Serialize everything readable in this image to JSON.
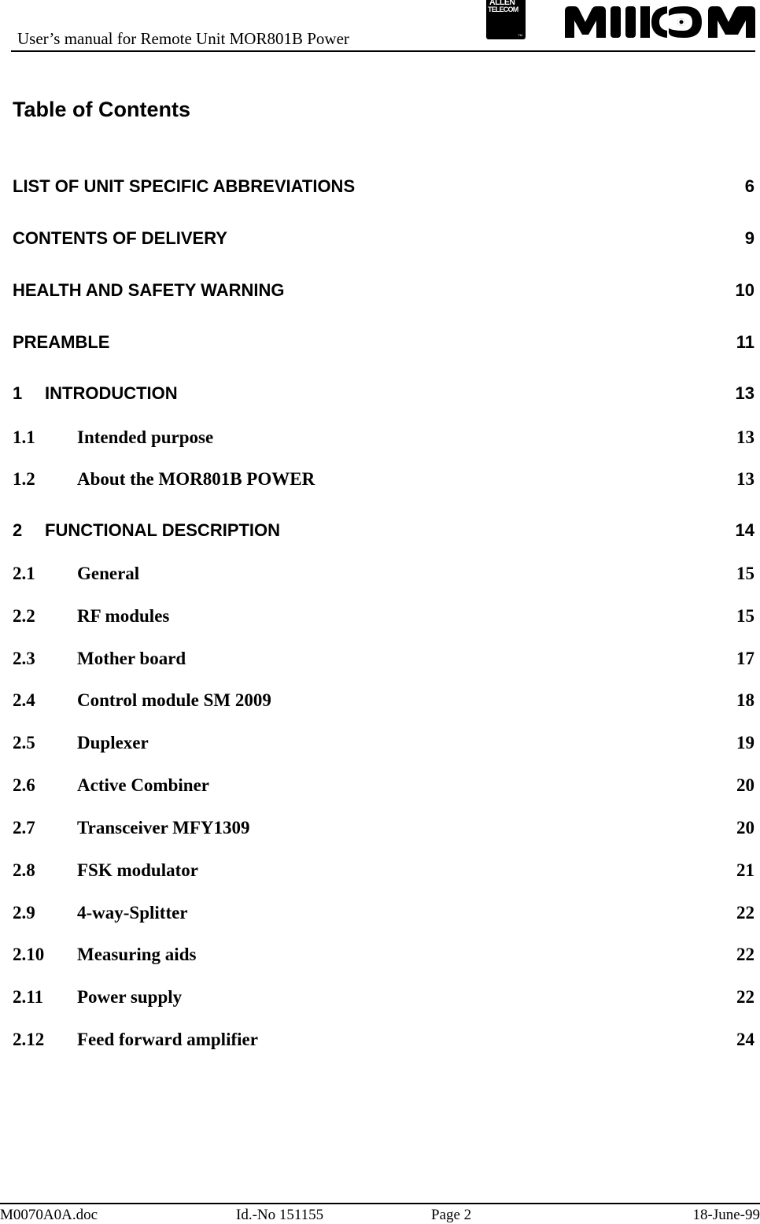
{
  "header": {
    "title": "User’s manual for Remote Unit MOR801B Power",
    "logos": {
      "allen_telecom": {
        "line1": "ALLEN",
        "line2": "TELECOM",
        "trademark": "TM"
      },
      "mikom": "MIKOM"
    }
  },
  "toc": {
    "title": "Table of Contents",
    "entries": [
      {
        "number": "",
        "label": "LIST OF UNIT SPECIFIC ABBREVIATIONS",
        "page": "6",
        "level": 0
      },
      {
        "number": "",
        "label": "CONTENTS OF DELIVERY",
        "page": "9",
        "level": 0
      },
      {
        "number": "",
        "label": "HEALTH AND SAFETY WARNING",
        "page": "10",
        "level": 0
      },
      {
        "number": "",
        "label": "PREAMBLE",
        "page": "11",
        "level": 0
      },
      {
        "number": "1",
        "label": "INTRODUCTION",
        "page": "13",
        "level": 1
      },
      {
        "number": "1.1",
        "label": "Intended purpose",
        "page": "13",
        "level": 2
      },
      {
        "number": "1.2",
        "label": "About the MOR801B POWER",
        "page": "13",
        "level": 2
      },
      {
        "number": "2",
        "label": "FUNCTIONAL DESCRIPTION",
        "page": "14",
        "level": 1
      },
      {
        "number": "2.1",
        "label": "General",
        "page": "15",
        "level": 2
      },
      {
        "number": "2.2",
        "label": "RF modules",
        "page": "15",
        "level": 2
      },
      {
        "number": "2.3",
        "label": "Mother board",
        "page": "17",
        "level": 2
      },
      {
        "number": "2.4",
        "label": "Control module SM 2009",
        "page": "18",
        "level": 2
      },
      {
        "number": "2.5",
        "label": "Duplexer",
        "page": "19",
        "level": 2
      },
      {
        "number": "2.6",
        "label": "Active Combiner",
        "page": "20",
        "level": 2
      },
      {
        "number": "2.7",
        "label": "Transceiver MFY1309",
        "page": "20",
        "level": 2
      },
      {
        "number": "2.8",
        "label": "FSK modulator",
        "page": "21",
        "level": 2
      },
      {
        "number": "2.9",
        "label": "4-way-Splitter",
        "page": "22",
        "level": 2
      },
      {
        "number": "2.10",
        "label": "Measuring aids",
        "page": "22",
        "level": 2
      },
      {
        "number": "2.11",
        "label": "Power supply",
        "page": "22",
        "level": 2
      },
      {
        "number": "2.12",
        "label": "Feed forward amplifier",
        "page": "24",
        "level": 2
      }
    ]
  },
  "footer": {
    "filename": "M0070A0A.doc",
    "id_number": "Id.-No 151155",
    "page": "Page 2",
    "date": "18-June-99"
  }
}
